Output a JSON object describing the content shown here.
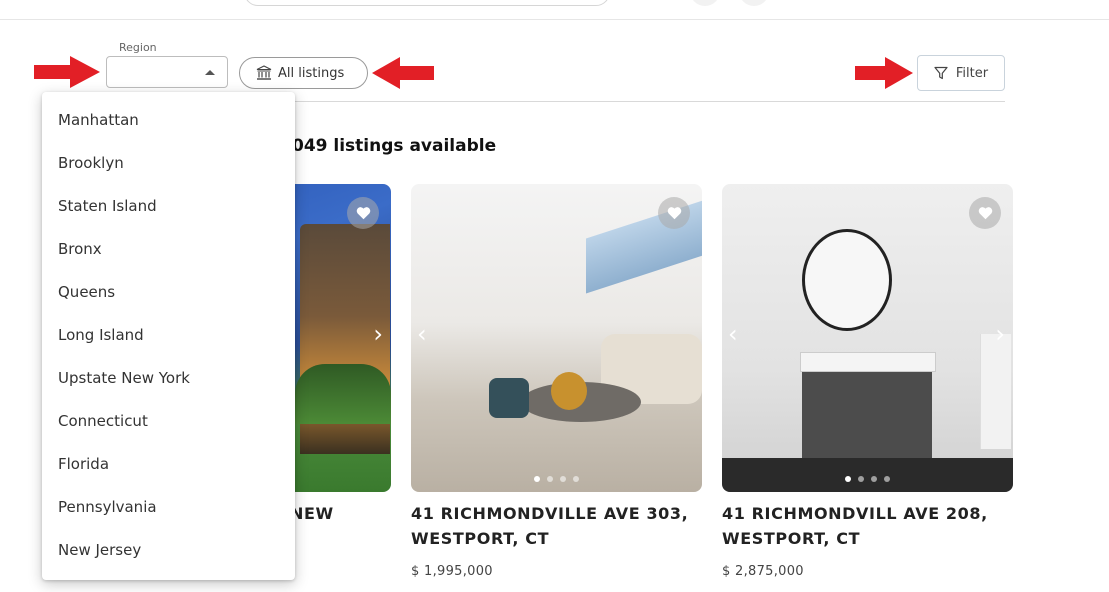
{
  "region": {
    "label": "Region",
    "value": ""
  },
  "all_listings_label": "All listings",
  "filter_label": "Filter",
  "listing_count_text": "049 listings available",
  "region_options": [
    "Manhattan",
    "Brooklyn",
    "Staten Island",
    "Bronx",
    "Queens",
    "Long Island",
    "Upstate New York",
    "Connecticut",
    "Florida",
    "Pennsylvania",
    "New Jersey"
  ],
  "cards": [
    {
      "address": "NEW",
      "price": ""
    },
    {
      "address": "41 RICHMONDVILLE AVE 303, WESTPORT, CT",
      "price": "$ 1,995,000"
    },
    {
      "address": "41 RICHMONDVILL AVE 208, WESTPORT, CT",
      "price": "$ 2,875,000"
    }
  ],
  "colors": {
    "annotation_arrow": "#e21f26",
    "accent_border": "#c9d3dc"
  }
}
